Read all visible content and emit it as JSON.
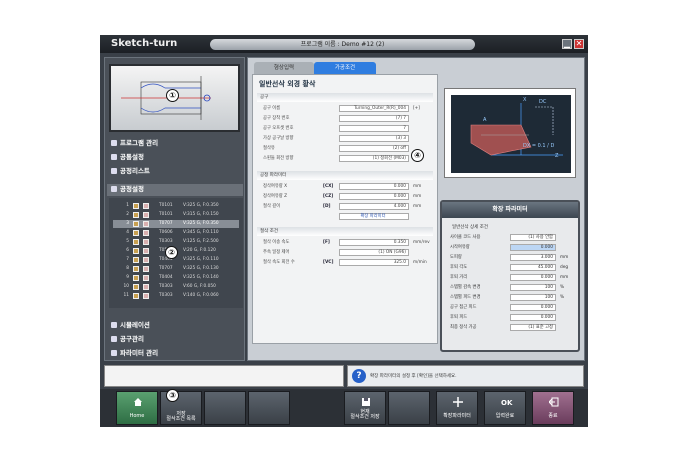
{
  "app": {
    "title": "Sketch-turn",
    "program_name": "프로그램 이름 : Demo #12 (2)",
    "min": "▁",
    "close": "✕"
  },
  "marks": [
    "①",
    "②",
    "③",
    "④"
  ],
  "nav": [
    {
      "label": "프로그램 관리"
    },
    {
      "label": "공통설정"
    },
    {
      "label": "공정리스트"
    },
    {
      "label": "공정설정"
    }
  ],
  "ops": [
    {
      "num": "1",
      "code": "T0101",
      "val": "V:325 G, F:0.350"
    },
    {
      "num": "2",
      "code": "T0101",
      "val": "V:315 G, F:0.150"
    },
    {
      "num": "3",
      "code": "T0707",
      "val": "V:325 G, F:0.350"
    },
    {
      "num": "4",
      "code": "T0606",
      "val": "V:345 G, F:0.110"
    },
    {
      "num": "5",
      "code": "T0303",
      "val": "V:125 G, F:2.500"
    },
    {
      "num": "6",
      "code": "T0505",
      "val": "V:20 G, F:0.120"
    },
    {
      "num": "7",
      "code": "T0404",
      "val": "V:325 G, F:0.110"
    },
    {
      "num": "8",
      "code": "T0707",
      "val": "V:325 G, F:0.130"
    },
    {
      "num": "9",
      "code": "T0404",
      "val": "V:325 G, F:0.140"
    },
    {
      "num": "10",
      "code": "T0303",
      "val": "V:60 G, F:0.050"
    },
    {
      "num": "11",
      "code": "T0303",
      "val": "V:140 G, F:0.060"
    }
  ],
  "bottom_nav": [
    "시뮬레이션",
    "공구관리",
    "파라미터 관리"
  ],
  "tabs": [
    "형상입력",
    "가공조건"
  ],
  "form": {
    "title": "일반선삭 외경 황삭",
    "sec_tool": "공구",
    "tool_rows": [
      {
        "label": "공구 이름",
        "value": "Turning_Outer_R(R)_004",
        "unit": "[+]"
      },
      {
        "label": "공구 장착 번호",
        "value": "(7) 7",
        "unit": ""
      },
      {
        "label": "공구 오프셋 번호",
        "value": "7",
        "unit": ""
      },
      {
        "label": "가상 공구날 방향",
        "value": "(3) 3",
        "unit": ""
      },
      {
        "label": "절삭유",
        "value": "(2) off",
        "unit": ""
      },
      {
        "label": "스핀들 회전 방향",
        "value": "(1) 정회전 (M03)",
        "unit": ""
      }
    ],
    "sec_depth": "공정 파라미터",
    "depth_rows": [
      {
        "label": "정삭여유량 X",
        "key": "[CX]",
        "value": "0.000",
        "unit": "mm"
      },
      {
        "label": "정삭여유량 Z",
        "key": "[CZ]",
        "value": "0.000",
        "unit": "mm"
      },
      {
        "label": "절삭 깊이",
        "key": "[D]",
        "value": "4.000",
        "unit": "mm"
      }
    ],
    "expert_link": "확장 파라미터",
    "sec_cond": "절삭 조건",
    "cond_rows": [
      {
        "label": "절삭 이송 속도",
        "key": "[F]",
        "value": "0.350",
        "unit": "mm/rev"
      },
      {
        "label": "주속 일정 제어",
        "key": "",
        "value": "(1) ON (G96)",
        "unit": ""
      },
      {
        "label": "절삭 속도 회전 수",
        "key": "[VC]",
        "value": "325.0",
        "unit": "m/min"
      }
    ]
  },
  "diagram": {
    "labels": [
      "X",
      "DC",
      "Z",
      "A",
      "DX = 0.1 / D"
    ]
  },
  "expert": {
    "title": "확장 파라미터",
    "section": "일반선삭 상세 조건",
    "rows": [
      {
        "label": "사이클 코드 사용",
        "value": "(1) 사용 안함",
        "unit": "",
        "blue": false
      },
      {
        "label": "시작여유량",
        "value": "0.000",
        "unit": "",
        "blue": true
      },
      {
        "label": "도피량",
        "value": "3.000",
        "unit": "mm",
        "blue": false
      },
      {
        "label": "후퇴 각도",
        "value": "45.000",
        "unit": "deg",
        "blue": false
      },
      {
        "label": "후퇴 거리",
        "value": "0.000",
        "unit": "mm",
        "blue": false
      },
      {
        "label": "스텝별 감속 변경",
        "value": "100",
        "unit": "%",
        "blue": false
      },
      {
        "label": "스텝별 피드 변경",
        "value": "100",
        "unit": "%",
        "blue": false
      },
      {
        "label": "공구 접근 피드",
        "value": "0.000",
        "unit": "",
        "blue": false
      },
      {
        "label": "후퇴 피드",
        "value": "0.000",
        "unit": "",
        "blue": false
      },
      {
        "label": "최종 정삭 가공",
        "value": "(1) 표준 고정",
        "unit": "",
        "blue": false
      }
    ]
  },
  "message": "확장 파라미터의 설정 후 [확인]을 선택하세요.",
  "toolbar": [
    {
      "label": "Home",
      "id": "home"
    },
    {
      "label": "저장\n절삭조건 목록",
      "id": "save-list"
    },
    {
      "label": "",
      "id": "blank1"
    },
    {
      "label": "",
      "id": "blank2"
    },
    {
      "label": "현재\n절삭조건 저장",
      "id": "save-current"
    },
    {
      "label": "",
      "id": "blank3"
    },
    {
      "label": "확장파라미터",
      "id": "expert-param"
    },
    {
      "label": "입력완료",
      "id": "input-done"
    },
    {
      "label": "종료",
      "id": "exit"
    }
  ]
}
